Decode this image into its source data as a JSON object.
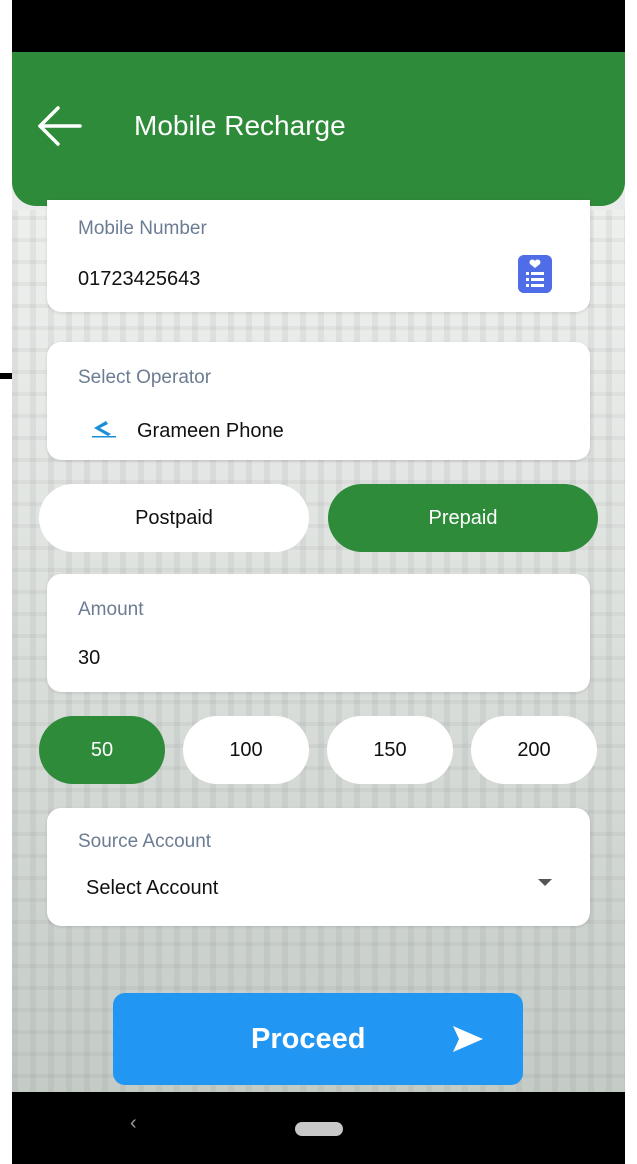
{
  "header": {
    "title": "Mobile Recharge",
    "back_icon": "arrow-left-icon"
  },
  "mobile_number": {
    "label": "Mobile Number",
    "value": "01723425643",
    "contact_icon": "contact-list-icon"
  },
  "operator": {
    "label": "Select Operator",
    "value": "Grameen Phone",
    "logo_icon": "grameenphone-logo-icon"
  },
  "plan_type": {
    "options": [
      {
        "label": "Postpaid",
        "selected": false
      },
      {
        "label": "Prepaid",
        "selected": true
      }
    ]
  },
  "amount": {
    "label": "Amount",
    "value": "30",
    "quick_options": [
      {
        "label": "50",
        "selected": true
      },
      {
        "label": "100",
        "selected": false
      },
      {
        "label": "150",
        "selected": false
      },
      {
        "label": "200",
        "selected": false
      }
    ]
  },
  "source_account": {
    "label": "Source Account",
    "value": "Select Account",
    "dropdown_icon": "caret-down-icon"
  },
  "proceed": {
    "label": "Proceed",
    "icon": "send-arrow-icon"
  },
  "nav": {
    "back_glyph": "‹",
    "home_icon": "home-pill-icon"
  },
  "colors": {
    "primary_green": "#2e8b3a",
    "button_blue": "#2196f3",
    "contact_icon_blue": "#4f6de6",
    "label_gray": "#6b7c93"
  }
}
